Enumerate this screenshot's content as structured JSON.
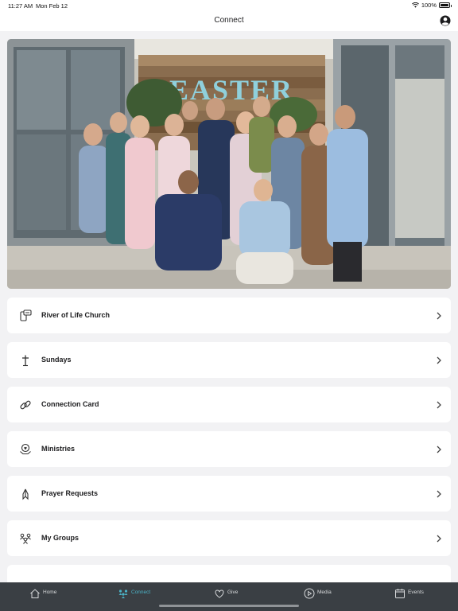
{
  "status_bar": {
    "time": "11:27 AM",
    "date": "Mon Feb 12",
    "battery": "100%"
  },
  "header": {
    "title": "Connect",
    "profile_icon": "person-circle-icon"
  },
  "hero": {
    "sign_text": "EASTER",
    "description": "group-photo"
  },
  "menu": {
    "items": [
      {
        "label": "River of Life Church",
        "icon": "info-phone-icon"
      },
      {
        "label": "Sundays",
        "icon": "cross-icon"
      },
      {
        "label": "Connection Card",
        "icon": "link-icon"
      },
      {
        "label": "Ministries",
        "icon": "hands-heart-icon"
      },
      {
        "label": "Prayer Requests",
        "icon": "praying-hands-icon"
      },
      {
        "label": "My Groups",
        "icon": "people-icon"
      }
    ]
  },
  "tabs": [
    {
      "label": "Home",
      "icon": "home-icon",
      "active": false
    },
    {
      "label": "Connect",
      "icon": "people-icon",
      "active": true
    },
    {
      "label": "Give",
      "icon": "heart-icon",
      "active": false
    },
    {
      "label": "Media",
      "icon": "play-icon",
      "active": false
    },
    {
      "label": "Events",
      "icon": "calendar-icon",
      "active": false
    }
  ],
  "colors": {
    "accent": "#4bb2c6",
    "tab_bar": "#3a3f44",
    "background": "#f2f2f4"
  }
}
